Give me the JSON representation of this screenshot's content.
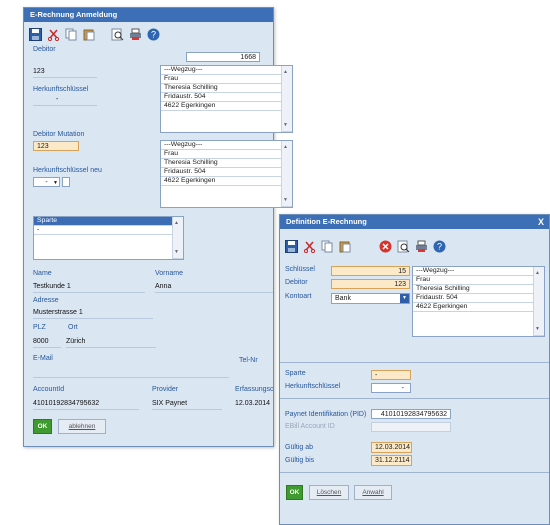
{
  "main": {
    "title": "E-Rechnung Anmeldung",
    "labels": {
      "debitor": "Debitor",
      "herkunft": "Herkunftschlüssel",
      "debitor_mutation": "Debitor Mutation",
      "herkunft_neu": "Herkunftschlüssel neu",
      "name": "Name",
      "vorname": "Vorname",
      "adresse": "Adresse",
      "plz": "PLZ",
      "ort": "Ort",
      "email": "E-Mail",
      "tel": "Tel-Nr",
      "accountid": "AccountId",
      "provider": "Provider",
      "erfassung": "Erfassungsc"
    },
    "values": {
      "debitor_number": "1668",
      "debitor": "123",
      "herkunft": "-",
      "debitor_mutation": "123",
      "herkunft_neu": "-",
      "name": "Testkunde 1",
      "vorname": "Anna",
      "adresse": "Musterstrasse 1",
      "plz": "8000",
      "ort": "Zürich",
      "accountid": "41010192834795632",
      "provider": "SIX Paynet",
      "erfassung": "12.03.2014"
    },
    "address1": [
      "---Wegzug---",
      "Frau",
      "Theresia Schilling",
      "Fridaustr. 504",
      "4622 Egerkingen"
    ],
    "address2": [
      "---Wegzug---",
      "Frau",
      "Theresia Schilling",
      "Fridaustr. 504",
      "4622 Egerkingen"
    ],
    "sparte_header": "Sparte",
    "sparte_row": "-",
    "ok_label": "OK",
    "ablehnen_label": "ablehnen"
  },
  "def": {
    "title": "Definition E-Rechnung",
    "close": "X",
    "labels": {
      "schluessel": "Schlüssel",
      "debitor": "Debitor",
      "kontoart": "Kontoart",
      "sparte": "Sparte",
      "herkunft": "Herkunftschlüssel",
      "pid": "Paynet Identifikation (PID)",
      "ebill": "EBill Account ID",
      "gueltig_ab": "Gültig ab",
      "gueltig_bis": "Gültig bis"
    },
    "values": {
      "schluessel": "15",
      "debitor": "123",
      "kontoart": "Bank",
      "sparte": "-",
      "herkunft": "-",
      "pid": "41010192834795632",
      "ebill": "",
      "gueltig_ab": "12.03.2014",
      "gueltig_bis": "31.12.2114"
    },
    "address": [
      "---Wegzug---",
      "Frau",
      "Theresia Schilling",
      "Fridaustr. 504",
      "4622 Egerkingen"
    ],
    "ok_label": "OK",
    "loeschen_label": "Löschen",
    "anwahl_label": "Anwahl"
  },
  "colors": {
    "titlebar": "#3c6fb5",
    "panel": "#dbe6f3",
    "label": "#25579b",
    "highlight": "#fce9c8",
    "ok": "#3f9b2f"
  }
}
